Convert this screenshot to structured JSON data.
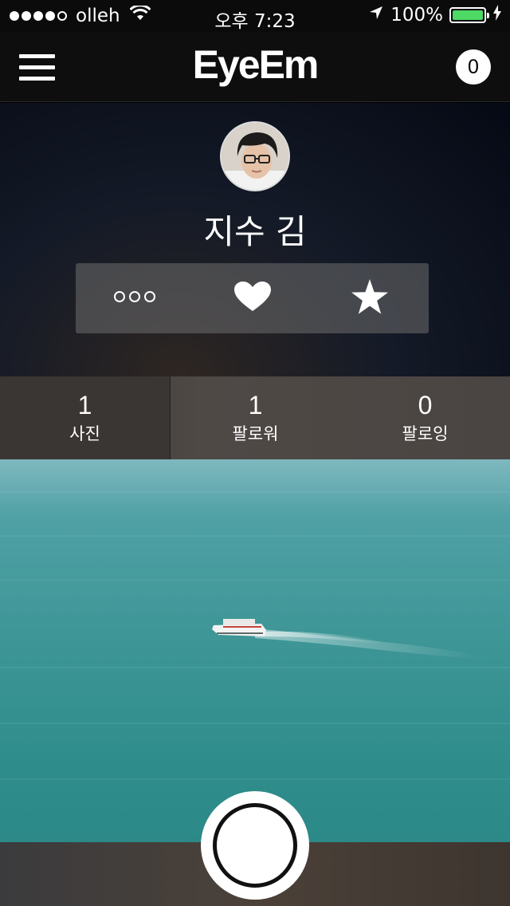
{
  "status_bar": {
    "carrier": "olleh",
    "time": "오후 7:23",
    "battery": "100%",
    "battery_level": 1.0
  },
  "nav": {
    "title": "EyeEm",
    "notification_count": "0"
  },
  "profile": {
    "name": "지수 김",
    "actions": [
      "more-options-icon",
      "heart-icon",
      "star-icon"
    ]
  },
  "stats": [
    {
      "value": "1",
      "label": "사진"
    },
    {
      "value": "1",
      "label": "팔로워"
    },
    {
      "value": "0",
      "label": "팔로잉"
    }
  ],
  "colors": {
    "battery_green": "#4cd964",
    "nav_background": "#0e0e0e",
    "sea": "#3f9697"
  }
}
